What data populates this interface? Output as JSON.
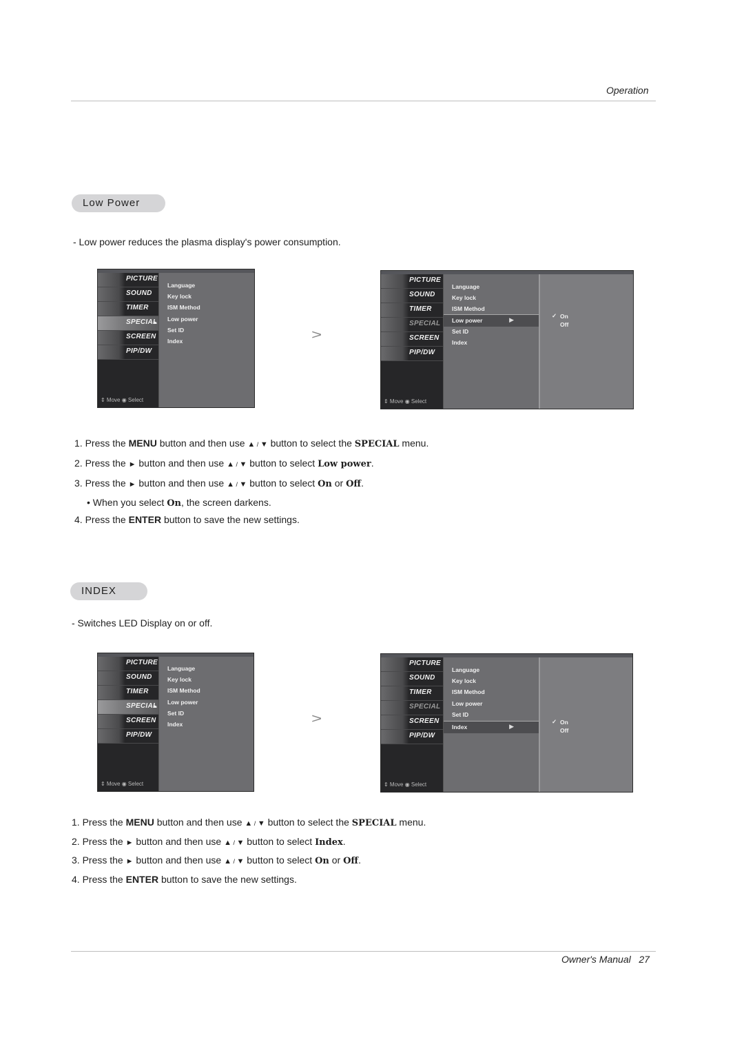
{
  "header": {
    "section": "Operation"
  },
  "footer": {
    "label": "Owner's Manual",
    "page": "27"
  },
  "low_power": {
    "title": "Low Power",
    "description": "-  Low power reduces the plasma display's power consumption.",
    "steps": [
      {
        "num": "1.",
        "pre": "Press the ",
        "b1": "MENU",
        "mid": " button and then use ",
        "up": "▲",
        "slash": " / ",
        "down": "▼",
        "post": "  button to select the ",
        "b2": "SPECIAL",
        "end": " menu."
      },
      {
        "num": "2.",
        "pre": "Press the ",
        "right": "►",
        "mid": "  button and then use ",
        "up": "▲",
        "slash": " / ",
        "down": "▼",
        "post": " button to select ",
        "b2": "Low power",
        "end": "."
      },
      {
        "num": "3.",
        "pre": "Press the ",
        "right": "►",
        "mid": "  button and then use ",
        "up": "▲",
        "slash": " / ",
        "down": "▼",
        "post": " button to select ",
        "b2": "On",
        "or": " or ",
        "b3": "Off",
        "end": "."
      },
      {
        "bullet": "• When you select ",
        "b2": "On",
        "end": ", the screen darkens."
      },
      {
        "num": "4.",
        "pre": "Press the ",
        "b1": "ENTER",
        "end": " button to save the new settings."
      }
    ]
  },
  "index": {
    "title": "INDEX",
    "description": "-  Switches LED Display on or off.",
    "steps": [
      {
        "num": "1.",
        "pre": "Press the ",
        "b1": "MENU",
        "mid": " button and then use ",
        "up": "▲",
        "slash": " / ",
        "down": "▼",
        "post": "  button to select the ",
        "b2": "SPECIAL",
        "end": " menu."
      },
      {
        "num": "2.",
        "pre": "Press the ",
        "right": "►",
        "mid": " button and then use ",
        "up": "▲",
        "slash": " / ",
        "down": "▼",
        "post": "  button to select ",
        "b2": "Index",
        "end": "."
      },
      {
        "num": "3.",
        "pre": "Press the ",
        "right": "►",
        "mid": " button and then use ",
        "up": "▲",
        "slash": " / ",
        "down": "▼",
        "post": " button to select ",
        "b2": "On",
        "or": " or ",
        "b3": "Off",
        "end": "."
      },
      {
        "num": "4.",
        "pre": "Press the ",
        "b1": "ENTER",
        "end": " button to save the new settings."
      }
    ]
  },
  "osd": {
    "main_menu": [
      "PICTURE",
      "SOUND",
      "TIMER",
      "SPECIAL",
      "SCREEN",
      "PIP/DW"
    ],
    "special_items": [
      "Language",
      "Key lock",
      "ISM Method",
      "Low power",
      "Set ID",
      "Index"
    ],
    "options": [
      "On",
      "Off"
    ],
    "check": "✓",
    "submenu_arrow": "▶",
    "main_arrow": "▸",
    "footer": "⇕ Move  ◉ Select",
    "transition_arrow": ">"
  }
}
